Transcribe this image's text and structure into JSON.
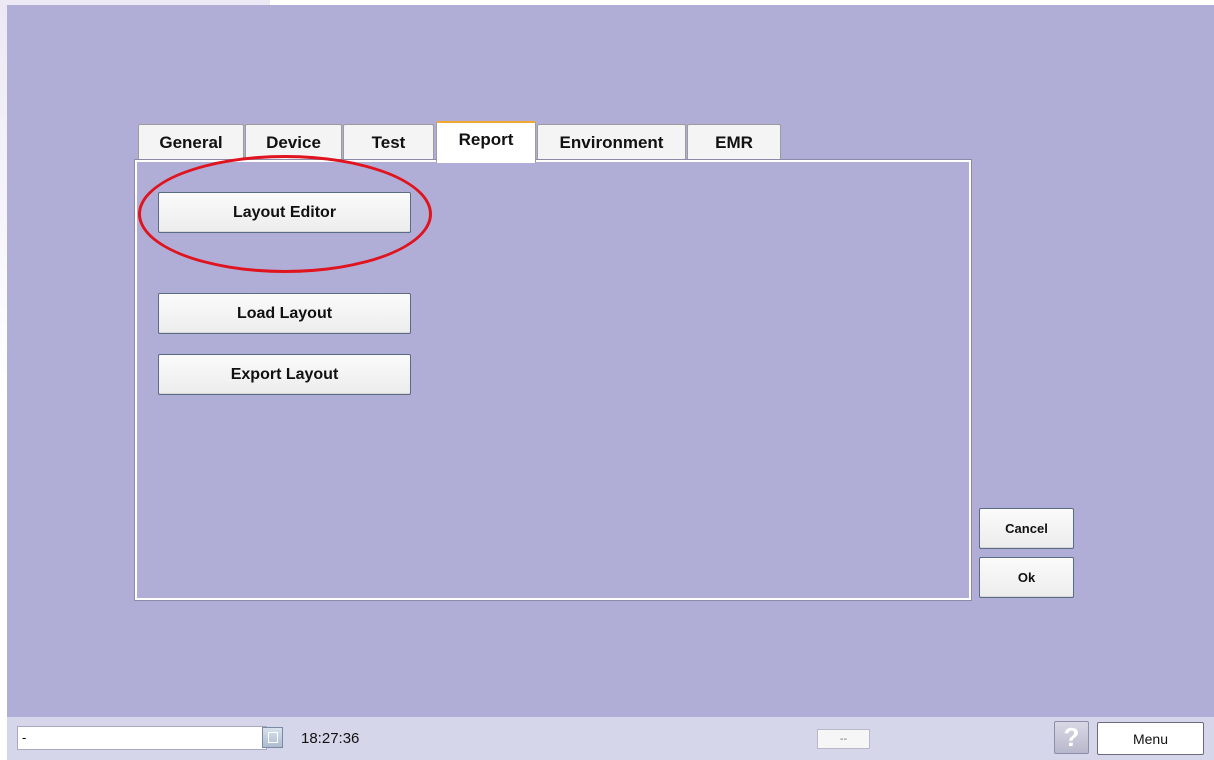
{
  "tabs": [
    {
      "label": "General"
    },
    {
      "label": "Device"
    },
    {
      "label": "Test"
    },
    {
      "label": "Report",
      "active": true
    },
    {
      "label": "Environment"
    },
    {
      "label": "EMR"
    }
  ],
  "report": {
    "layout_editor_label": "Layout Editor",
    "load_layout_label": "Load Layout",
    "export_layout_label": "Export Layout"
  },
  "dialog": {
    "cancel_label": "Cancel",
    "ok_label": "Ok"
  },
  "statusbar": {
    "field_value": "-",
    "clock": "18:27:36",
    "center_value": "--",
    "help_icon": "?",
    "menu_label": "Menu"
  },
  "colors": {
    "background": "#b0aed6",
    "active_tab_accent": "#f0a830",
    "highlight": "#e0141e"
  },
  "icons": {
    "restore": "restore-window-icon",
    "help": "help-icon"
  }
}
